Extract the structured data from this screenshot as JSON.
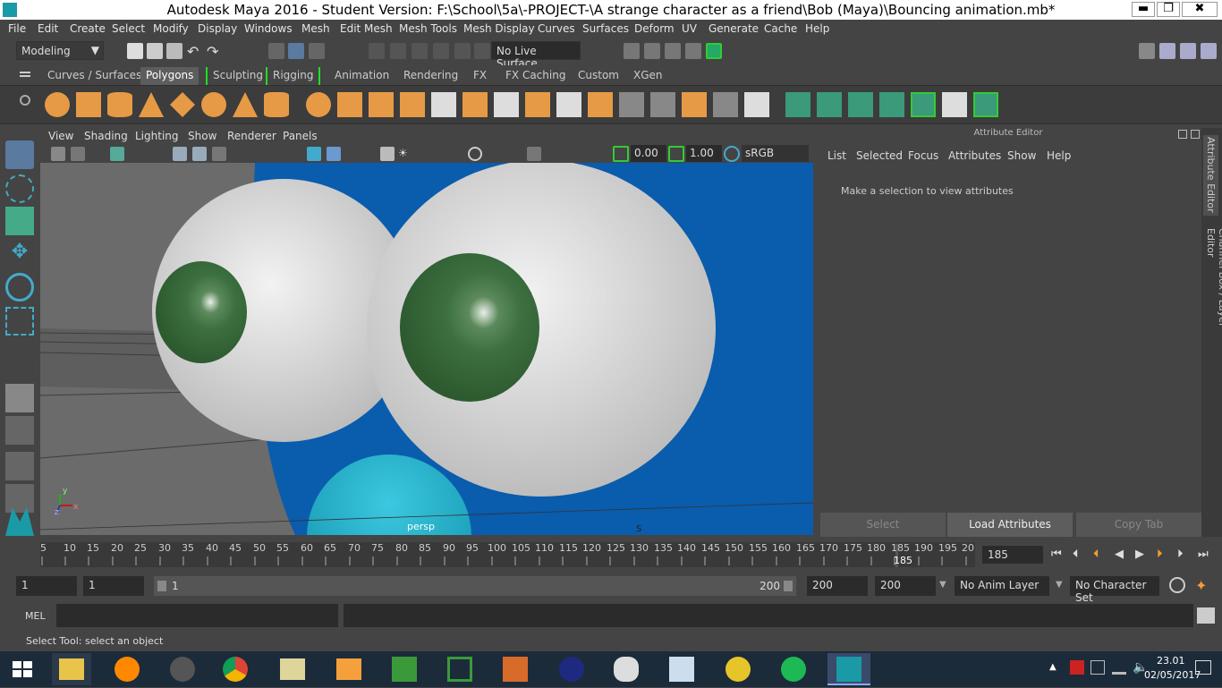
{
  "window": {
    "title": "Autodesk Maya 2016 - Student Version: F:\\School\\5a\\-PROJECT-\\A strange character as a friend\\Bob (Maya)\\Bouncing animation.mb*",
    "min": "▬",
    "max": "❐",
    "close": "✖"
  },
  "menubar": [
    "File",
    "Edit",
    "Create",
    "Select",
    "Modify",
    "Display",
    "Windows",
    "Mesh",
    "Edit Mesh",
    "Mesh Tools",
    "Mesh Display",
    "Curves",
    "Surfaces",
    "Deform",
    "UV",
    "Generate",
    "Cache",
    "Help"
  ],
  "toolbar": {
    "menuset": "Modeling",
    "live_surface": "No Live Surface"
  },
  "shelf_tabs": [
    "Curves / Surfaces",
    "Polygons",
    "Sculpting",
    "Rigging",
    "Animation",
    "Rendering",
    "FX",
    "FX Caching",
    "Custom",
    "XGen"
  ],
  "viewport": {
    "menus": [
      "View",
      "Shading",
      "Lighting",
      "Show",
      "Renderer",
      "Panels"
    ],
    "exposure": "0.00",
    "gamma": "1.00",
    "colorspace": "sRGB gamma",
    "camera_label": "persp",
    "axis_y": "y",
    "axis_x": "x",
    "axis_z": "z",
    "pivot_label": "S"
  },
  "attribute_editor": {
    "header": "Attribute Editor",
    "menus": [
      "List",
      "Selected",
      "Focus",
      "Attributes",
      "Show",
      "Help"
    ],
    "message": "Make a selection to view attributes",
    "buttons": [
      "Select",
      "Load Attributes",
      "Copy Tab"
    ]
  },
  "side_tabs": [
    "Attribute Editor",
    "Channel Box / Layer Editor"
  ],
  "timeline": {
    "ticks": [
      "5",
      "10",
      "15",
      "20",
      "25",
      "30",
      "35",
      "40",
      "45",
      "50",
      "55",
      "60",
      "65",
      "70",
      "75",
      "80",
      "85",
      "90",
      "95",
      "100",
      "105",
      "110",
      "115",
      "120",
      "125",
      "130",
      "135",
      "140",
      "145",
      "150",
      "155",
      "160",
      "165",
      "170",
      "175",
      "180",
      "185",
      "190",
      "195",
      "20"
    ],
    "current_frame_marker": "185",
    "current_frame_field": "185"
  },
  "range": {
    "start": "1",
    "start2": "1",
    "slider_start": "1",
    "slider_end": "200",
    "end": "200",
    "end2": "200",
    "anim_layer": "No Anim Layer",
    "char_set": "No Character Set"
  },
  "command": {
    "mel_label": "MEL"
  },
  "status": {
    "text": "Select Tool: select an object"
  },
  "taskbar": {
    "time": "23.01",
    "date": "02/05/2017"
  }
}
